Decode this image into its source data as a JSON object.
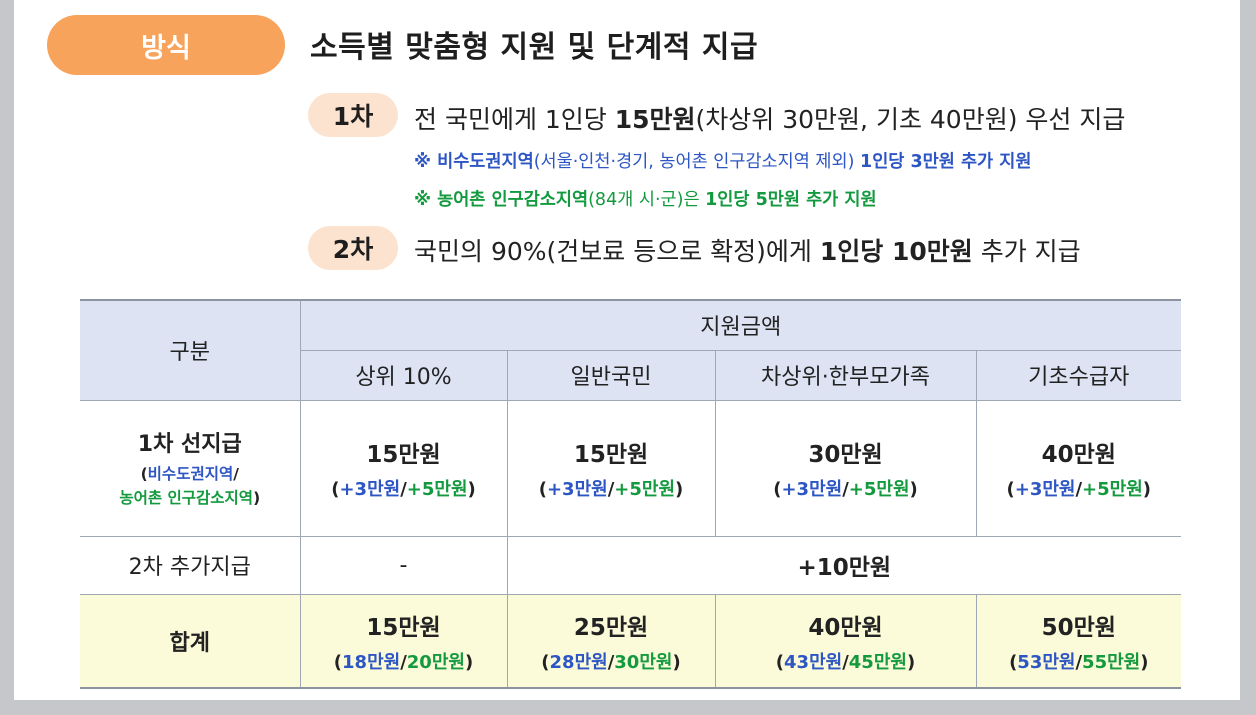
{
  "badge": "방식",
  "headline": "소득별 맞춤형 지원 및 단계적 지급",
  "step1": {
    "badge": "1차",
    "pre": "전 국민에게 1인당 ",
    "bold": "15만원",
    "post": "(차상위 30만원, 기초 40만원) 우선 지급",
    "note1_bold": "※ 비수도권지역",
    "note1_plain": "(서울·인천·경기, 농어촌 인구감소지역 제외) ",
    "note1_tail": "1인당 3만원 추가 지원",
    "note2_bold": "※ 농어촌 인구감소지역",
    "note2_plain": "(84개 시·군)은 ",
    "note2_tail": "1인당 5만원 추가 지원"
  },
  "step2": {
    "badge": "2차",
    "pre": "국민의 90%(건보료 등으로 확정)에게 ",
    "bold": "1인당 10만원",
    "post": " 추가 지급"
  },
  "table": {
    "col_header": "구분",
    "group_header": "지원금액",
    "columns": [
      "상위 10%",
      "일반국민",
      "차상위·한부모가족",
      "기초수급자"
    ],
    "row1": {
      "label": "1차 선지급",
      "sub_open": "(",
      "sub_blue": "비수도권지역",
      "sub_slash": "/",
      "sub_green": "농어촌 인구감소지역",
      "sub_close": ")",
      "cells": [
        {
          "main": "15만원",
          "a": "+3만원",
          "b": "+5만원"
        },
        {
          "main": "15만원",
          "a": "+3만원",
          "b": "+5만원"
        },
        {
          "main": "30만원",
          "a": "+3만원",
          "b": "+5만원"
        },
        {
          "main": "40만원",
          "a": "+3만원",
          "b": "+5만원"
        }
      ]
    },
    "row2": {
      "label": "2차 추가지급",
      "first": "-",
      "rest": "+10만원"
    },
    "row3": {
      "label": "합계",
      "cells": [
        {
          "main": "15만원",
          "a": "18만원",
          "b": "20만원"
        },
        {
          "main": "25만원",
          "a": "28만원",
          "b": "30만원"
        },
        {
          "main": "40만원",
          "a": "43만원",
          "b": "45만원"
        },
        {
          "main": "50만원",
          "a": "53만원",
          "b": "55만원"
        }
      ]
    }
  },
  "colors": {
    "badge_orange": "#f7a35c",
    "step_badge": "#fce3cf",
    "blue": "#2d56c4",
    "green": "#139a3e",
    "header_bg": "#dde3f3",
    "total_bg": "#fbfbd9"
  }
}
